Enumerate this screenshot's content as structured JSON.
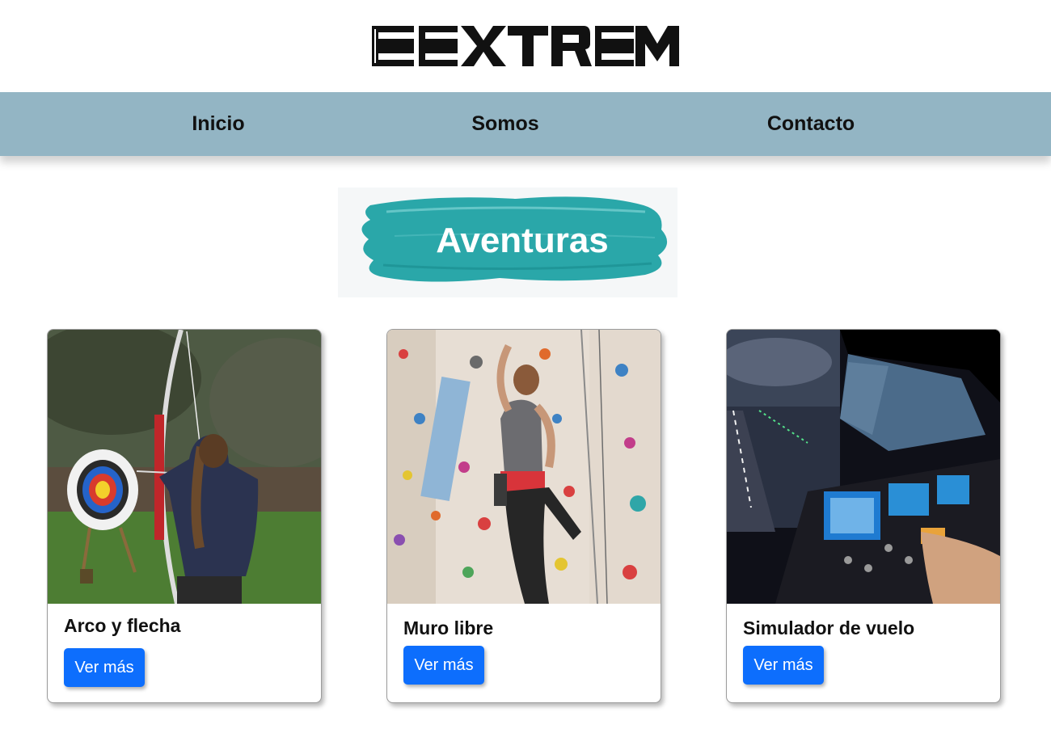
{
  "header": {
    "logo_text": "EXTREM"
  },
  "nav": {
    "items": [
      {
        "label": "Inicio"
      },
      {
        "label": "Somos"
      },
      {
        "label": "Contacto"
      }
    ],
    "background_color": "#93b5c4"
  },
  "section": {
    "title": "Aventuras",
    "brush_color": "#2aa7a9"
  },
  "cards": [
    {
      "title": "Arco y flecha",
      "button_label": "Ver más",
      "image": "archery-photo"
    },
    {
      "title": "Muro libre",
      "button_label": "Ver más",
      "image": "climbing-wall-photo"
    },
    {
      "title": "Simulador de vuelo",
      "button_label": "Ver más",
      "image": "flight-simulator-photo"
    }
  ],
  "colors": {
    "button": "#0d6efd"
  }
}
